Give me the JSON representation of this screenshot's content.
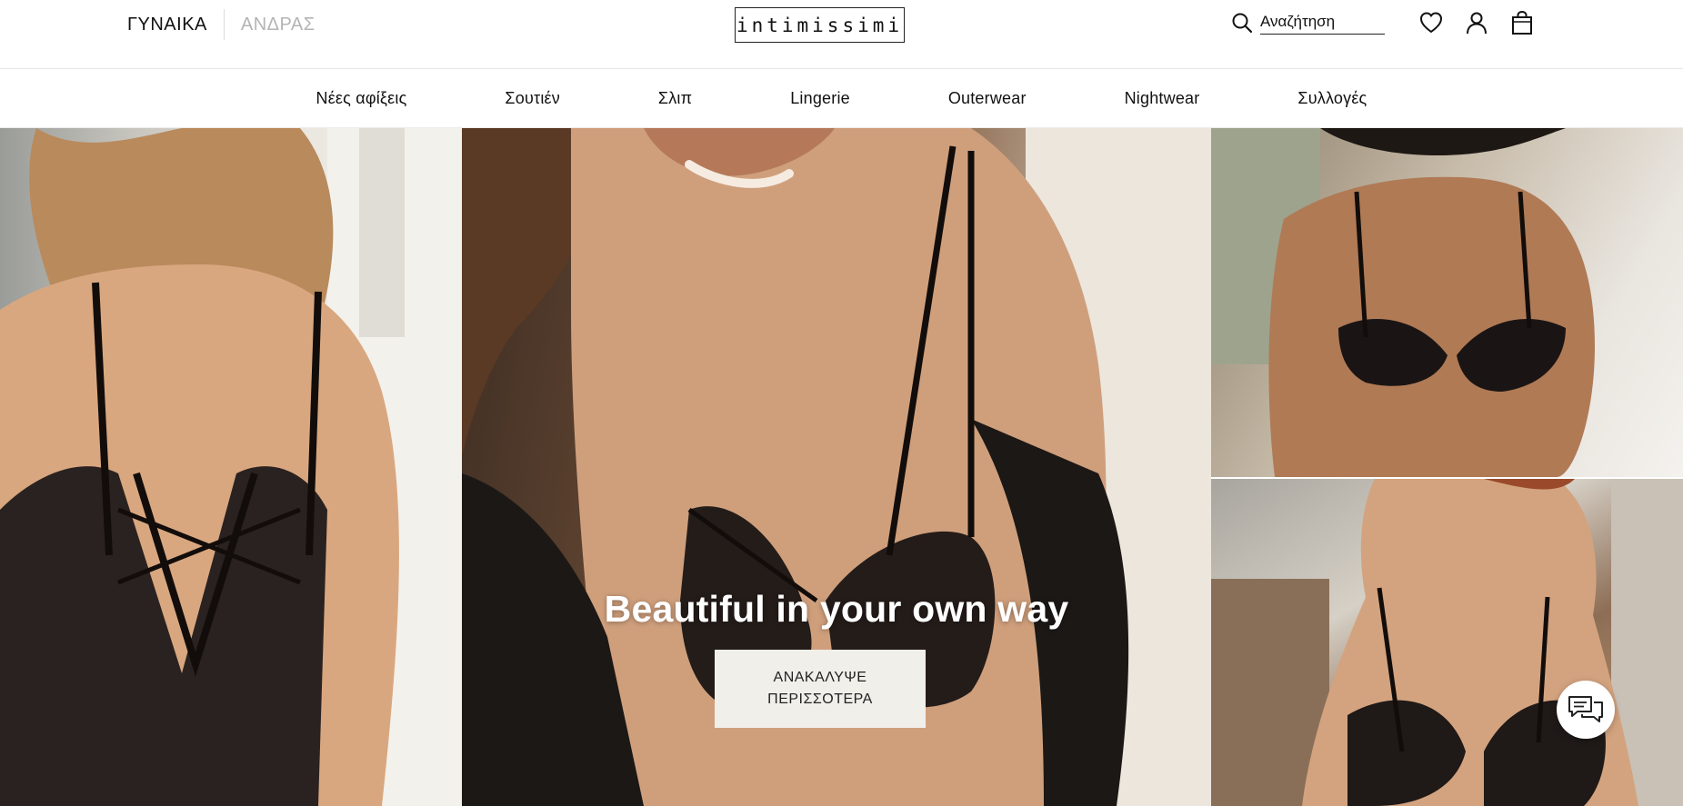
{
  "header": {
    "gender_tabs": [
      {
        "label": "ΓΥΝΑΙΚΑ",
        "active": true
      },
      {
        "label": "ΑΝΔΡΑΣ",
        "active": false
      }
    ],
    "logo_text": "intimissimi",
    "search": {
      "placeholder": "Αναζήτηση",
      "value": ""
    },
    "icons": [
      "search-icon",
      "heart-icon",
      "user-icon",
      "shopping-bag-icon"
    ]
  },
  "category_nav": {
    "items": [
      "Νέες αφίξεις",
      "Σουτιέν",
      "Σλιπ",
      "Lingerie",
      "Outerwear",
      "Nightwear",
      "Συλλογές"
    ]
  },
  "hero": {
    "title": "Beautiful in your own way",
    "cta_label": "ΑΝΑΚΑΛΥΨΕ ΠΕΡΙΣΣΟΤΕΡΑ"
  },
  "chat": {
    "icon": "chat-icon"
  },
  "colors": {
    "text": "#111111",
    "muted_tab": "#b4b4b4",
    "cta_background": "#f1efea",
    "border": "#e6e6e6"
  }
}
